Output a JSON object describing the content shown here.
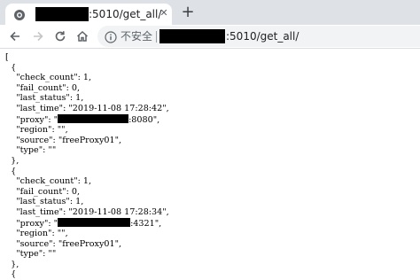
{
  "browser": {
    "tab": {
      "title": ":5010/get_all/"
    },
    "security_label": "不安全",
    "url_suffix": ":5010/get_all/"
  },
  "json_view": {
    "open_bracket": "[",
    "close_bracket": "]",
    "entries": [
      {
        "open": "{",
        "close": "},",
        "lines": {
          "check_count": "\"check_count\": 1,",
          "fail_count": "\"fail_count\": 0,",
          "last_status": "\"last_status\": 1,",
          "last_time": "\"last_time\": \"2019-11-08 17:28:42\",",
          "proxy_key": "\"proxy\": \"",
          "proxy_tail": ":8080\",",
          "region": "\"region\": \"\",",
          "source": "\"source\": \"freeProxy01\",",
          "type": "\"type\": \"\""
        }
      },
      {
        "open": "{",
        "close": "},",
        "lines": {
          "check_count": "\"check_count\": 1,",
          "fail_count": "\"fail_count\": 0,",
          "last_status": "\"last_status\": 1,",
          "last_time": "\"last_time\": \"2019-11-08 17:28:34\",",
          "proxy_key": "\"proxy\": \"",
          "proxy_tail": ":4321\",",
          "region": "\"region\": \"\",",
          "source": "\"source\": \"freeProxy01\",",
          "type": "\"type\": \"\""
        }
      }
    ],
    "trailing_open": "{"
  }
}
